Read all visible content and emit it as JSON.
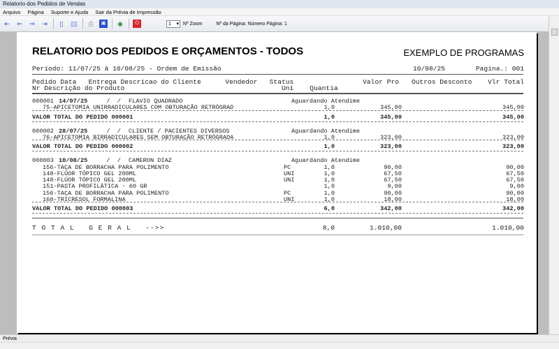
{
  "window": {
    "title": "Relatorio dos Pedidos de Vendas"
  },
  "menu": [
    "Arquivo",
    "Página",
    "Suporte e Ajuda",
    "Sair da Prévia de Impressão"
  ],
  "toolbar": {
    "zoom_value": "1",
    "zoom_label": "Nº Zoom",
    "page_label": "Nº da Página: Número Página: 1"
  },
  "report": {
    "title": "RELATORIO DOS PEDIDOS E ORÇAMENTOS - TODOS",
    "company": "EXEMPLO DE PROGRAMAS",
    "period": "Período: 11/07/25 à 10/08/25 - Ordem de Emissão",
    "date": "10/08/25",
    "page": "Pagina.: 001",
    "header1": "Pedido Data   Entrega Descricao do Cliente      Vendedor   Status",
    "header1_right": [
      "Valor Pro",
      "Outros Desconto",
      "Vlr Total"
    ],
    "header2": "Nr Descrição do Produto",
    "header2_right": "Uni    Quantia",
    "orders": [
      {
        "num": "000001",
        "date": "14/07/25",
        "delivery": "  /  /",
        "client": "FLAVIO QUADRADO",
        "status": "Aguardando Atendime",
        "items": [
          {
            "desc": "75-APICETOMIA UNIRRADICULARES COM OBTURAÇÃO RETRÓGRAD",
            "uni": "",
            "qty": "1,0",
            "price": "345,00",
            "total": "345,00"
          }
        ],
        "total_label": "VALOR TOTAL DO PEDIDO 000001",
        "total_qty": "1,0",
        "total_price": "345,00",
        "total_value": "345,00"
      },
      {
        "num": "000002",
        "date": "28/07/25",
        "delivery": "  /  /",
        "client": "CLIENTE / PACIENTES DIVERSOS",
        "status": "Aguardando Atendime",
        "items": [
          {
            "desc": "76-APICETOMIA BIRRADICULARES SEM OBTURAÇÃO RETRÓGRADA",
            "uni": "",
            "qty": "1,0",
            "price": "323,00",
            "total": "323,00"
          }
        ],
        "total_label": "VALOR TOTAL DO PEDIDO 000002",
        "total_qty": "1,0",
        "total_price": "323,00",
        "total_value": "323,00"
      },
      {
        "num": "000003",
        "date": "10/08/25",
        "delivery": "  /  /",
        "client": "CAMERON DIAZ",
        "status": "Aguardando Atendime",
        "items": [
          {
            "desc": "156-TAÇA DE BORRACHA PARA POLIMENTO",
            "uni": "PC",
            "qty": "1,0",
            "price": "90,00",
            "total": "90,00"
          },
          {
            "desc": "148-FLÚOR TÓPICO GEL 200ML",
            "uni": "UNI",
            "qty": "1,0",
            "price": "67,50",
            "total": "67,50"
          },
          {
            "desc": "148-FLÚOR TÓPICO GEL 200ML",
            "uni": "UNI",
            "qty": "1,0",
            "price": "67,50",
            "total": "67,50"
          },
          {
            "desc": "151-PASTA PROFILÁTICA - 60 GR",
            "uni": "",
            "qty": "1,0",
            "price": "9,00",
            "total": "9,00"
          },
          {
            "desc": "156-TAÇA DE BORRACHA PARA POLIMENTO",
            "uni": "PC",
            "qty": "1,0",
            "price": "90,00",
            "total": "90,00"
          },
          {
            "desc": "160-TRICRESOL FORMALINA",
            "uni": "UNI",
            "qty": "1,0",
            "price": "18,00",
            "total": "18,00"
          }
        ],
        "total_label": "VALOR TOTAL DO PEDIDO 000003",
        "total_qty": "6,0",
        "total_price": "342,00",
        "total_value": "342,00"
      }
    ],
    "grand_label": "T O T A L   G E R A L   -->>",
    "grand_qty": "8,0",
    "grand_price": "1.010,00",
    "grand_total": "1.010,00"
  },
  "statusbar": {
    "text": "Prévia"
  }
}
